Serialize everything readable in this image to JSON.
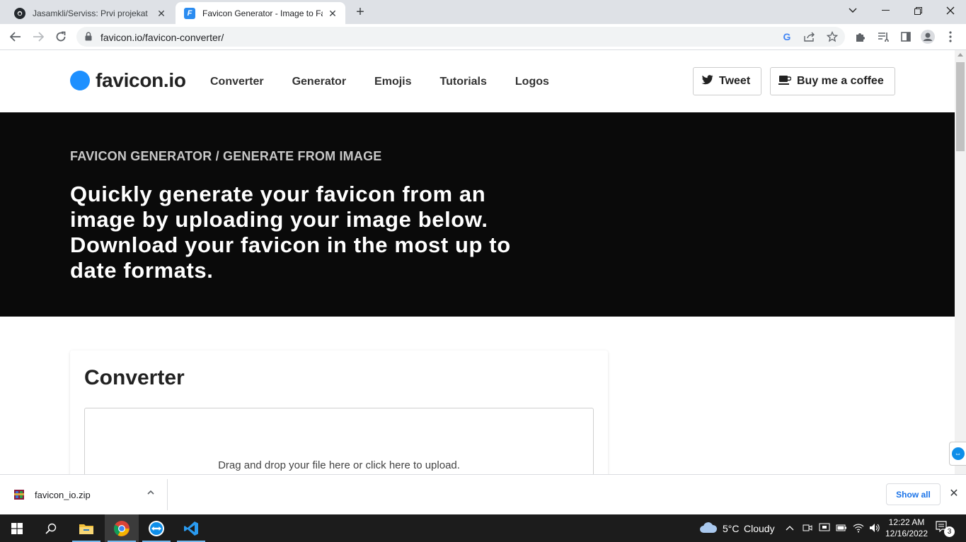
{
  "browser": {
    "tabs": [
      {
        "title": "Jasamkli/Serviss: Prvi projekat",
        "favicon": "github-icon",
        "active": false
      },
      {
        "title": "Favicon Generator - Image to Favicon",
        "favicon": "favicon-io-icon",
        "active": true
      }
    ],
    "new_tab_symbol": "+",
    "url": "favicon.io/favicon-converter/"
  },
  "site": {
    "logo_text": "favicon.io",
    "logo_color": "#1e90ff",
    "nav": [
      "Converter",
      "Generator",
      "Emojis",
      "Tutorials",
      "Logos"
    ],
    "tweet_label": "Tweet",
    "coffee_label": "Buy me a coffee"
  },
  "hero": {
    "breadcrumb": "FAVICON GENERATOR / GENERATE FROM IMAGE",
    "headline": "Quickly generate your favicon from an image by uploading your image below. Download your favicon in the most up to date formats."
  },
  "converter": {
    "title": "Converter",
    "dropzone_hint": "Drag and drop your file here or click here to upload."
  },
  "downloads": {
    "file_name": "favicon_io.zip",
    "show_all_label": "Show all"
  },
  "taskbar": {
    "weather_temp": "5°C",
    "weather_desc": "Cloudy",
    "time": "12:22 AM",
    "date": "12/16/2022",
    "notification_count": "3"
  }
}
